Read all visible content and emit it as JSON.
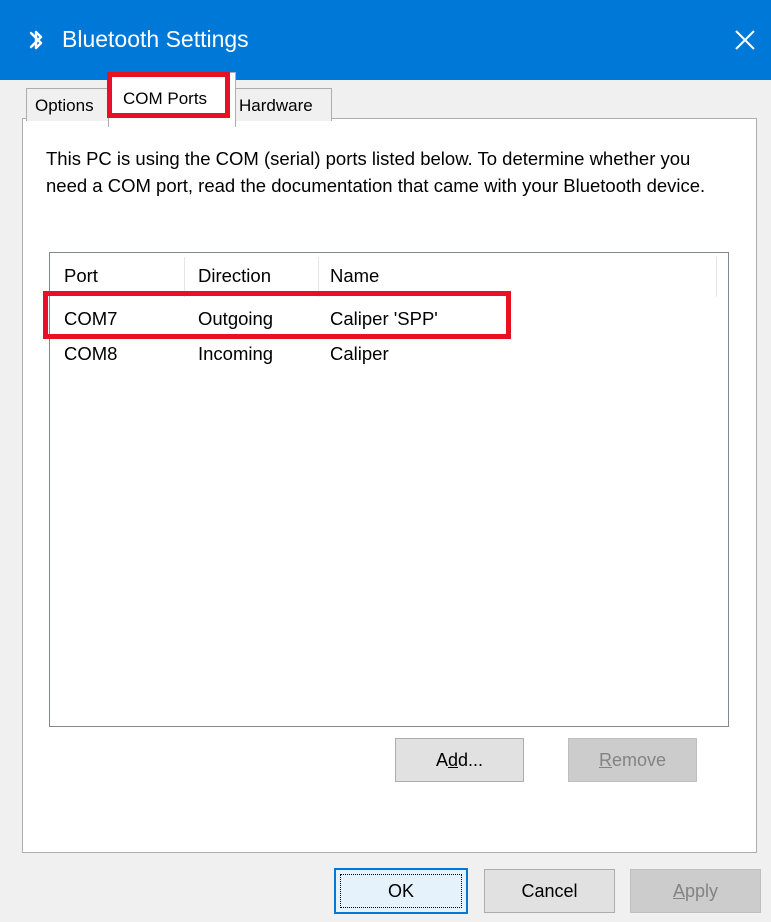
{
  "window": {
    "title": "Bluetooth Settings",
    "accent": "#0078d7",
    "title_icon": "bluetooth-icon",
    "close_icon": "close-icon"
  },
  "tabs": [
    {
      "label": "Options",
      "selected": false
    },
    {
      "label": "COM Ports",
      "selected": true
    },
    {
      "label": "Hardware",
      "selected": false
    }
  ],
  "description": "This PC is using the COM (serial) ports listed below. To determine whether you need a COM port, read the documentation that came with your Bluetooth device.",
  "ports": {
    "columns": [
      "Port",
      "Direction",
      "Name"
    ],
    "rows": [
      {
        "port": "COM7",
        "direction": "Outgoing",
        "name": "Caliper 'SPP'"
      },
      {
        "port": "COM8",
        "direction": "Incoming",
        "name": "Caliper"
      }
    ]
  },
  "buttons": {
    "add": {
      "pre": "A",
      "access": "d",
      "post": "d..."
    },
    "remove": {
      "pre": "",
      "access": "R",
      "post": "emove"
    },
    "ok": "OK",
    "cancel": "Cancel",
    "apply": {
      "pre": "",
      "access": "A",
      "post": "pply"
    }
  },
  "highlight_color": "#e81123"
}
